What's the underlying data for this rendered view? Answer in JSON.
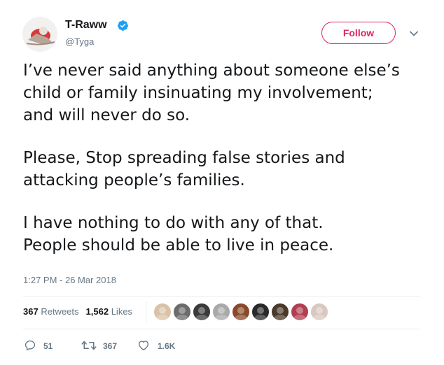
{
  "user": {
    "display_name": "T-Raww",
    "handle": "@Tyga",
    "verified": true
  },
  "follow_button": {
    "label": "Follow"
  },
  "tweet": {
    "paragraphs": [
      [
        "I’ve never said anything about someone else’s",
        "child or family insinuating my involvement;",
        "and will never do so."
      ],
      [
        "Please, Stop spreading false stories and",
        "attacking people’s families."
      ],
      [
        "I have nothing to do with any of that.",
        "People should be able to live in peace."
      ]
    ],
    "timestamp": "1:27 PM - 26 Mar 2018"
  },
  "stats": {
    "retweets_count": "367",
    "retweets_label": "Retweets",
    "likes_count": "1,562",
    "likes_label": "Likes"
  },
  "likers": [
    {
      "icon": "liker-avatar-icon",
      "color": "#d9c3a8"
    },
    {
      "icon": "liker-avatar-icon",
      "color": "#6b6b6b"
    },
    {
      "icon": "liker-avatar-icon",
      "color": "#3a3a3a"
    },
    {
      "icon": "liker-avatar-icon",
      "color": "#a9a9a9"
    },
    {
      "icon": "liker-avatar-icon",
      "color": "#8a4a2a"
    },
    {
      "icon": "liker-avatar-icon",
      "color": "#2a2a2a"
    },
    {
      "icon": "liker-avatar-icon",
      "color": "#4a3a2a"
    },
    {
      "icon": "liker-avatar-icon",
      "color": "#b04050"
    },
    {
      "icon": "liker-avatar-icon",
      "color": "#d8c8c0"
    }
  ],
  "actions": {
    "replies": "51",
    "retweets": "367",
    "likes": "1.6K"
  },
  "colors": {
    "accent_follow": "#e0245e",
    "verified_blue": "#1da1f2",
    "muted_text": "#657786",
    "divider": "#e6ecf0"
  }
}
